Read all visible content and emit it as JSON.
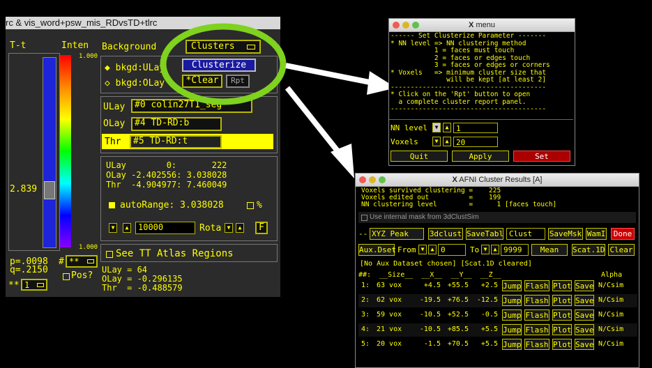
{
  "afni_main": {
    "window_title": "rc & vis_word+psw_mis_RDvsTD+tlrc",
    "col_tt": "T-t",
    "col_inten": "Inten",
    "scale_max": "1.000",
    "scale_min": "1.000",
    "bar_value": "2.839",
    "p_value": "p=.0098",
    "q_value": "q=.2150",
    "hash_label": "#",
    "hash_menu": "**",
    "star_menu": "**",
    "star_value": "1",
    "pos_label": "Pos?",
    "background_label": "Background",
    "clusters_menu": "Clusters",
    "bkgd_ulay": "bkgd:ULay",
    "bkgd_olay": "bkgd:OLay",
    "clusterize_button": "Clusterize",
    "clear_button": "*Clear",
    "rpt_button": "Rpt",
    "ulay_label": "ULay",
    "ulay_value": "#0 colin27T1_seg",
    "olay_label": "OLay",
    "olay_value": "#4 TD-RD:b",
    "thr_label": "Thr",
    "thr_value": "#5 TD-RD:t",
    "info_ulay": "ULay        0:       222",
    "info_olay": "OLay -2.402556: 3.038028",
    "info_thr": "Thr  -4.904977: 7.460049",
    "autorange_label": "autoRange: 3.038028",
    "percent_label": "%",
    "spin_value": "10000",
    "rota_label": "Rota",
    "f_button": "F",
    "tt_atlas_label": "See TT Atlas Regions",
    "bottom_ulay": "ULay = 64",
    "bottom_olay": "OLay = -0.296135",
    "bottom_thr": "Thr  = -0.488579"
  },
  "menu_window": {
    "title": "menu",
    "lines": [
      "------ Set Clusterize Parameter -------",
      "* NN level => NN clustering method",
      "           1 = faces must touch",
      "           2 = faces or edges touch",
      "           3 = faces or edges or corners",
      "* Voxels   => minimum cluster size that",
      "              will be kept [at least 2]",
      "---------------------------------------",
      "* Click on the 'Rpt' button to open",
      "  a complete cluster report panel.",
      "---------------------------------------"
    ],
    "nn_label": "NN level",
    "nn_value": "1",
    "voxels_label": "Voxels",
    "voxels_value": "20",
    "quit_button": "Quit",
    "apply_button": "Apply",
    "set_button": "Set"
  },
  "cluster_window": {
    "title": "AFNI Cluster Results [A]",
    "header_lines": [
      "Voxels survived clustering =    225",
      "Voxels edited out          =    199",
      "NN clustering level        =      1 [faces touch]"
    ],
    "mask_label": "Use internal mask from 3dClustSim",
    "dash": "--",
    "xyz_label": "XYZ",
    "peak_menu": "Peak",
    "btn_3dclust": "3dclust",
    "btn_savetabl": "SaveTabl",
    "clust_field": "Clust",
    "btn_savemsk": "SaveMsk",
    "btn_wami": "WamI",
    "btn_done": "Done",
    "aux_dset": "Aux.Dset",
    "from_label": "From",
    "from_value": "0",
    "to_label": "To",
    "to_value": "9999",
    "mean_menu": "Mean",
    "btn_scat": "Scat.1D",
    "btn_clear": "Clear",
    "aux_status": "[No Aux Dataset chosen] [Scat.1D cleared]",
    "columns": "##:  __Size__  __X__  __Y__  __Z__",
    "alpha_label": "Alpha",
    "row_buttons": {
      "jump": "Jump",
      "flash": "Flash",
      "plot": "Plot",
      "save": "Save"
    },
    "rows": [
      {
        "idx": "1:",
        "size": "63 vox",
        "x": "+4.5",
        "y": "+55.5",
        "z": "+2.5",
        "alpha": "N/Csim"
      },
      {
        "idx": "2:",
        "size": "62 vox",
        "x": "-19.5",
        "y": "+76.5",
        "z": "-12.5",
        "alpha": "N/Csim"
      },
      {
        "idx": "3:",
        "size": "59 vox",
        "x": "-10.5",
        "y": "+52.5",
        "z": "-0.5",
        "alpha": "N/Csim"
      },
      {
        "idx": "4:",
        "size": "21 vox",
        "x": "-10.5",
        "y": "+85.5",
        "z": "+5.5",
        "alpha": "N/Csim"
      },
      {
        "idx": "5:",
        "size": "20 vox",
        "x": "-1.5",
        "y": "+70.5",
        "z": "+5.5",
        "alpha": "N/Csim"
      }
    ]
  },
  "colors": {
    "accent": "#ffff00",
    "highlight_ring": "#7fd21e",
    "done": "#cc0000",
    "set": "#aa0000"
  }
}
